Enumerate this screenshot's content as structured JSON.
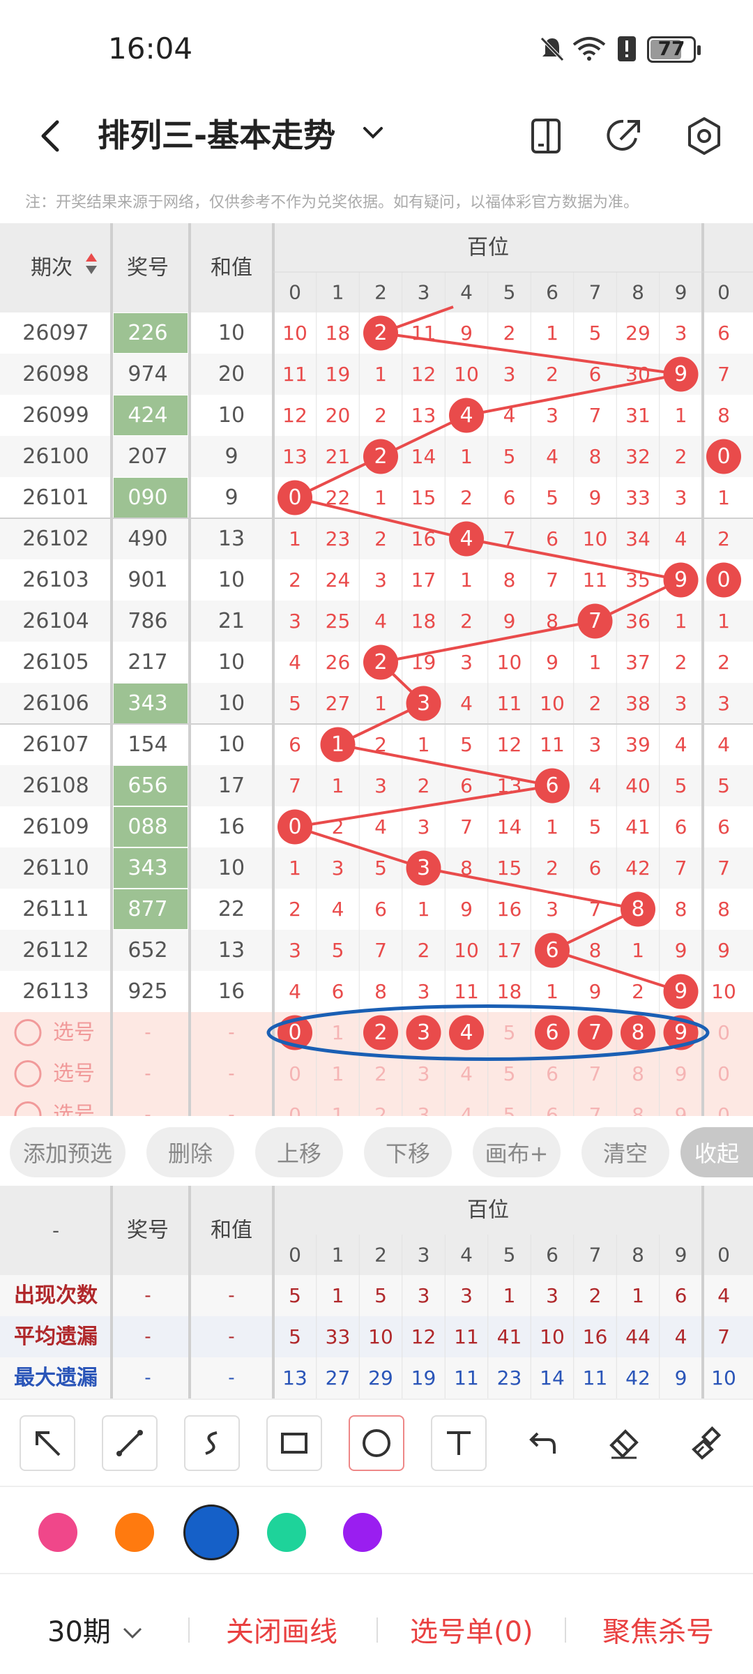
{
  "status_bar": {
    "time": "16:04",
    "battery": "77",
    "icons": [
      "mute-icon",
      "wifi-icon",
      "alert-icon",
      "battery-icon"
    ]
  },
  "header": {
    "title": "排列三-基本走势",
    "icons": [
      "back-icon",
      "chevron-down-icon",
      "phone-layout-icon",
      "share-icon",
      "settings-icon"
    ]
  },
  "notice": "注：开奖结果来源于网络，仅供参考不作为兑奖依据。如有疑问，以福体彩官方数据为准。",
  "table": {
    "headers": {
      "period": "期次",
      "number": "奖号",
      "sum": "和值",
      "group": "百位",
      "next_digit": "0"
    },
    "digits": [
      "0",
      "1",
      "2",
      "3",
      "4",
      "5",
      "6",
      "7",
      "8",
      "9"
    ],
    "colors": {
      "hit": "#e94b4b",
      "miss_text": "#e94b4b",
      "green_cell": "#9dc293",
      "oval": "#1a5fb4"
    },
    "rows": [
      {
        "period": "26097",
        "number": "226",
        "green": true,
        "sum": "10",
        "cells": [
          "10",
          "18",
          "2",
          "11",
          "9",
          "2",
          "1",
          "5",
          "29",
          "3"
        ],
        "hit": 2,
        "next": "6"
      },
      {
        "period": "26098",
        "number": "974",
        "green": false,
        "sum": "20",
        "cells": [
          "11",
          "19",
          "1",
          "12",
          "10",
          "3",
          "2",
          "6",
          "30",
          "9"
        ],
        "hit": 9,
        "next": "7"
      },
      {
        "period": "26099",
        "number": "424",
        "green": true,
        "sum": "10",
        "cells": [
          "12",
          "20",
          "2",
          "13",
          "4",
          "4",
          "3",
          "7",
          "31",
          "1"
        ],
        "hit": 4,
        "next": "8"
      },
      {
        "period": "26100",
        "number": "207",
        "green": false,
        "sum": "9",
        "cells": [
          "13",
          "21",
          "2",
          "14",
          "1",
          "5",
          "4",
          "8",
          "32",
          "2"
        ],
        "hit": 2,
        "next": "0",
        "next_hit": true
      },
      {
        "period": "26101",
        "number": "090",
        "green": true,
        "sum": "9",
        "cells": [
          "0",
          "22",
          "1",
          "15",
          "2",
          "6",
          "5",
          "9",
          "33",
          "3"
        ],
        "hit": 0,
        "next": "1"
      },
      {
        "period": "26102",
        "number": "490",
        "green": false,
        "sum": "13",
        "cells": [
          "1",
          "23",
          "2",
          "16",
          "4",
          "7",
          "6",
          "10",
          "34",
          "4"
        ],
        "hit": 4,
        "next": "2"
      },
      {
        "period": "26103",
        "number": "901",
        "green": false,
        "sum": "10",
        "cells": [
          "2",
          "24",
          "3",
          "17",
          "1",
          "8",
          "7",
          "11",
          "35",
          "9"
        ],
        "hit": 9,
        "next": "0",
        "next_hit": true
      },
      {
        "period": "26104",
        "number": "786",
        "green": false,
        "sum": "21",
        "cells": [
          "3",
          "25",
          "4",
          "18",
          "2",
          "9",
          "8",
          "7",
          "36",
          "1"
        ],
        "hit": 7,
        "next": "1"
      },
      {
        "period": "26105",
        "number": "217",
        "green": false,
        "sum": "10",
        "cells": [
          "4",
          "26",
          "2",
          "19",
          "3",
          "10",
          "9",
          "1",
          "37",
          "2"
        ],
        "hit": 2,
        "next": "2"
      },
      {
        "period": "26106",
        "number": "343",
        "green": true,
        "sum": "10",
        "cells": [
          "5",
          "27",
          "1",
          "3",
          "4",
          "11",
          "10",
          "2",
          "38",
          "3"
        ],
        "hit": 3,
        "next": "3"
      },
      {
        "period": "26107",
        "number": "154",
        "green": false,
        "sum": "10",
        "cells": [
          "6",
          "1",
          "2",
          "1",
          "5",
          "12",
          "11",
          "3",
          "39",
          "4"
        ],
        "hit": 1,
        "next": "4"
      },
      {
        "period": "26108",
        "number": "656",
        "green": true,
        "sum": "17",
        "cells": [
          "7",
          "1",
          "3",
          "2",
          "6",
          "13",
          "6",
          "4",
          "40",
          "5"
        ],
        "hit": 6,
        "next": "5"
      },
      {
        "period": "26109",
        "number": "088",
        "green": true,
        "sum": "16",
        "cells": [
          "0",
          "2",
          "4",
          "3",
          "7",
          "14",
          "1",
          "5",
          "41",
          "6"
        ],
        "hit": 0,
        "next": "6"
      },
      {
        "period": "26110",
        "number": "343",
        "green": true,
        "sum": "10",
        "cells": [
          "1",
          "3",
          "5",
          "3",
          "8",
          "15",
          "2",
          "6",
          "42",
          "7"
        ],
        "hit": 3,
        "next": "7"
      },
      {
        "period": "26111",
        "number": "877",
        "green": true,
        "sum": "22",
        "cells": [
          "2",
          "4",
          "6",
          "1",
          "9",
          "16",
          "3",
          "7",
          "8",
          "8"
        ],
        "hit": 8,
        "next": "8"
      },
      {
        "period": "26112",
        "number": "652",
        "green": false,
        "sum": "13",
        "cells": [
          "3",
          "5",
          "7",
          "2",
          "10",
          "17",
          "6",
          "8",
          "1",
          "9"
        ],
        "hit": 6,
        "next": "9"
      },
      {
        "period": "26113",
        "number": "925",
        "green": false,
        "sum": "16",
        "cells": [
          "4",
          "6",
          "8",
          "3",
          "11",
          "18",
          "1",
          "9",
          "2",
          "9"
        ],
        "hit": 9,
        "next": "10"
      }
    ],
    "select_rows": [
      {
        "label": "选号",
        "number": "-",
        "sum": "-",
        "selected": [
          0,
          2,
          3,
          4,
          6,
          7,
          8,
          9
        ],
        "next": "0"
      },
      {
        "label": "选号",
        "number": "-",
        "sum": "-",
        "selected": [],
        "next": "0"
      },
      {
        "label": "选号",
        "number": "-",
        "sum": "-",
        "selected": [],
        "next": "0"
      }
    ]
  },
  "toolbar": [
    "添加预选",
    "删除",
    "上移",
    "下移",
    "画布+",
    "清空",
    "收起"
  ],
  "stats": {
    "headers": {
      "label": "-",
      "number": "奖号",
      "sum": "和值",
      "group": "百位",
      "next_digit": "0"
    },
    "digits": [
      "0",
      "1",
      "2",
      "3",
      "4",
      "5",
      "6",
      "7",
      "8",
      "9"
    ],
    "rows": [
      {
        "label": "出现次数",
        "color": "#b0282b",
        "number": "-",
        "sum": "-",
        "cells": [
          "5",
          "1",
          "5",
          "3",
          "3",
          "1",
          "3",
          "2",
          "1",
          "6"
        ],
        "next": "4"
      },
      {
        "label": "平均遗漏",
        "color": "#b0282b",
        "number": "-",
        "sum": "-",
        "cells": [
          "5",
          "33",
          "10",
          "12",
          "11",
          "41",
          "10",
          "16",
          "44",
          "4"
        ],
        "next": "7"
      },
      {
        "label": "最大遗漏",
        "color": "#2a55b8",
        "number": "-",
        "sum": "-",
        "cells": [
          "13",
          "27",
          "29",
          "19",
          "11",
          "23",
          "14",
          "11",
          "42",
          "9"
        ],
        "next": "10"
      }
    ]
  },
  "draw_tools": [
    "arrow-tool-icon",
    "line-tool-icon",
    "curve-tool-icon",
    "rect-tool-icon",
    "circle-tool-icon",
    "text-tool-icon",
    "undo-icon",
    "eraser-icon",
    "clear-brush-icon"
  ],
  "palette": [
    "#f0478a",
    "#ff7a0f",
    "#1560c8",
    "#1ed39a",
    "#9a1ef0"
  ],
  "bottom_bar": {
    "period_select": "30期",
    "close_lines": "关闭画线",
    "selection_list": "选号单(0)",
    "focus_kill": "聚焦杀号"
  }
}
